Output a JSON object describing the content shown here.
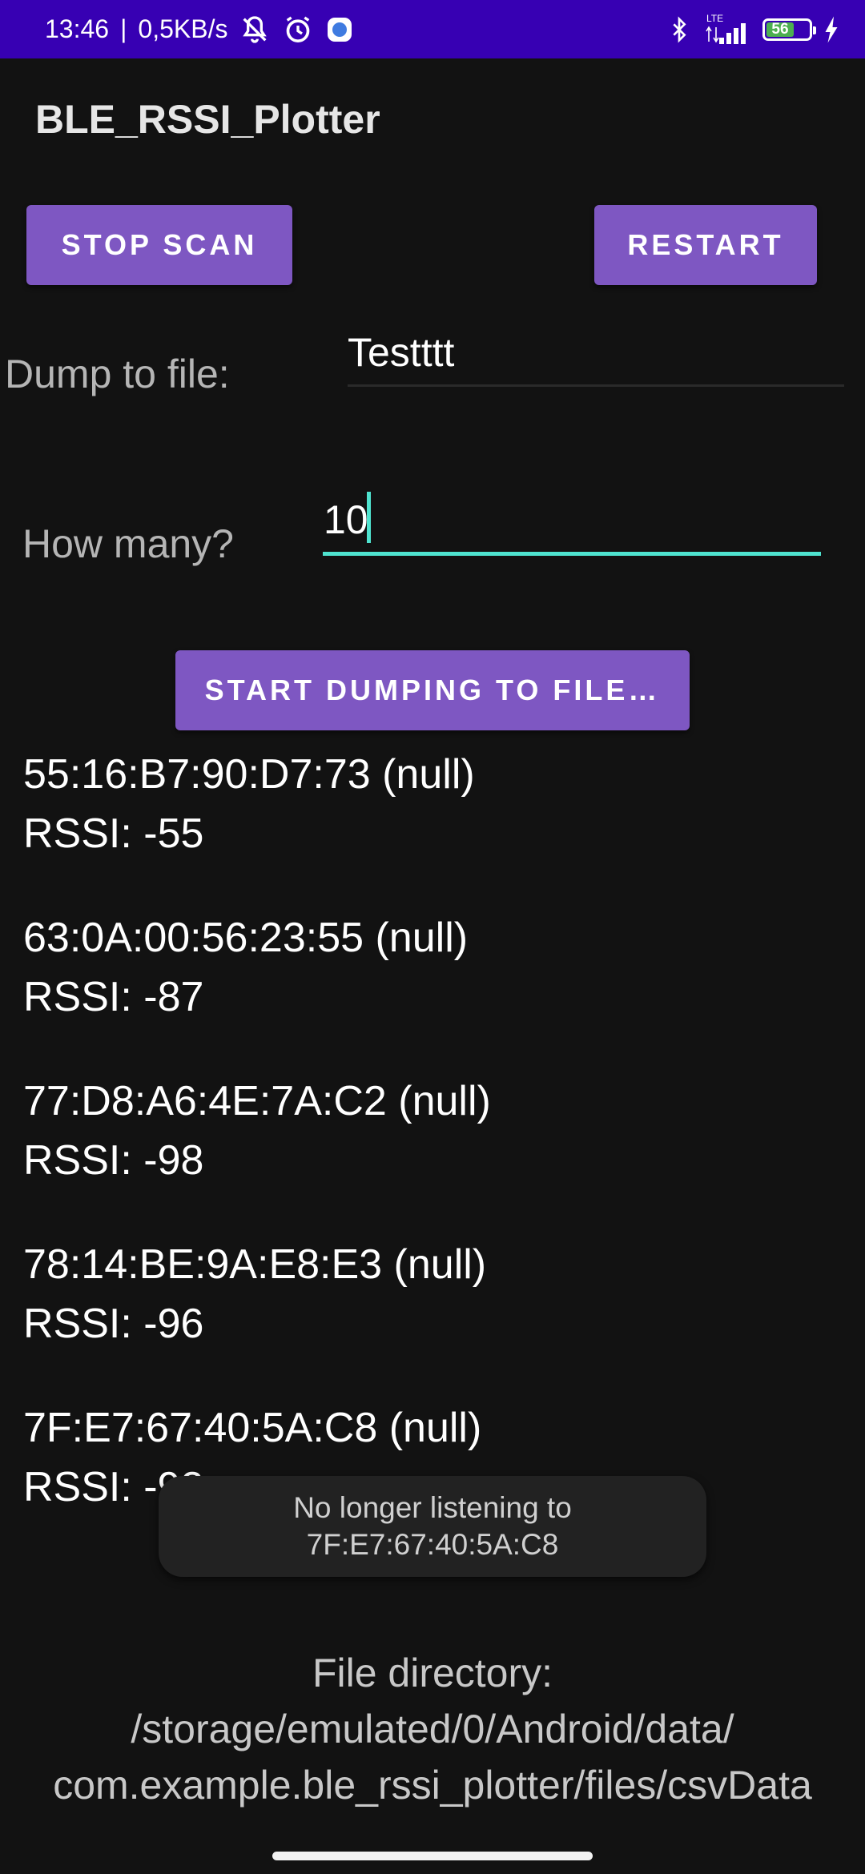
{
  "status_bar": {
    "time": "13:46",
    "separator": "|",
    "speed": "0,5KB/s",
    "network_label": "LTE",
    "battery_level": "56",
    "battery_fraction": 0.56,
    "colors": {
      "background": "#3700b3",
      "battery": "#4caf50"
    },
    "icons": [
      "bell-off-icon",
      "alarm-icon",
      "app-notification-icon",
      "bluetooth-icon",
      "signal-icon",
      "battery-icon",
      "charging-icon"
    ]
  },
  "app": {
    "title": "BLE_RSSI_Plotter"
  },
  "buttons": {
    "stop_scan": "STOP SCAN",
    "restart": "RESTART",
    "start_dumping": "START DUMPING TO FILE…"
  },
  "form": {
    "dump_label": "Dump to file:",
    "filename_value": "Testttt",
    "howmany_label": "How many?",
    "count_value": "10"
  },
  "devices": [
    {
      "address": "55:16:B7:90:D7:73 (null)",
      "rssi": "RSSI: -55"
    },
    {
      "address": "63:0A:00:56:23:55 (null)",
      "rssi": "RSSI: -87"
    },
    {
      "address": "77:D8:A6:4E:7A:C2 (null)",
      "rssi": "RSSI: -98"
    },
    {
      "address": "78:14:BE:9A:E8:E3 (null)",
      "rssi": "RSSI: -96"
    },
    {
      "address": "7F:E7:67:40:5A:C8 (null)",
      "rssi": "RSSI: -92"
    }
  ],
  "toast": {
    "line1": "No longer listening to",
    "line2": "7F:E7:67:40:5A:C8"
  },
  "footer": {
    "line1": "File directory:",
    "line2": "/storage/emulated/0/Android/data/",
    "line3": "com.example.ble_rssi_plotter/files/csvData"
  },
  "theme": {
    "accent": "#7e57c2",
    "focus": "#4fe3cf",
    "background": "#121212"
  }
}
